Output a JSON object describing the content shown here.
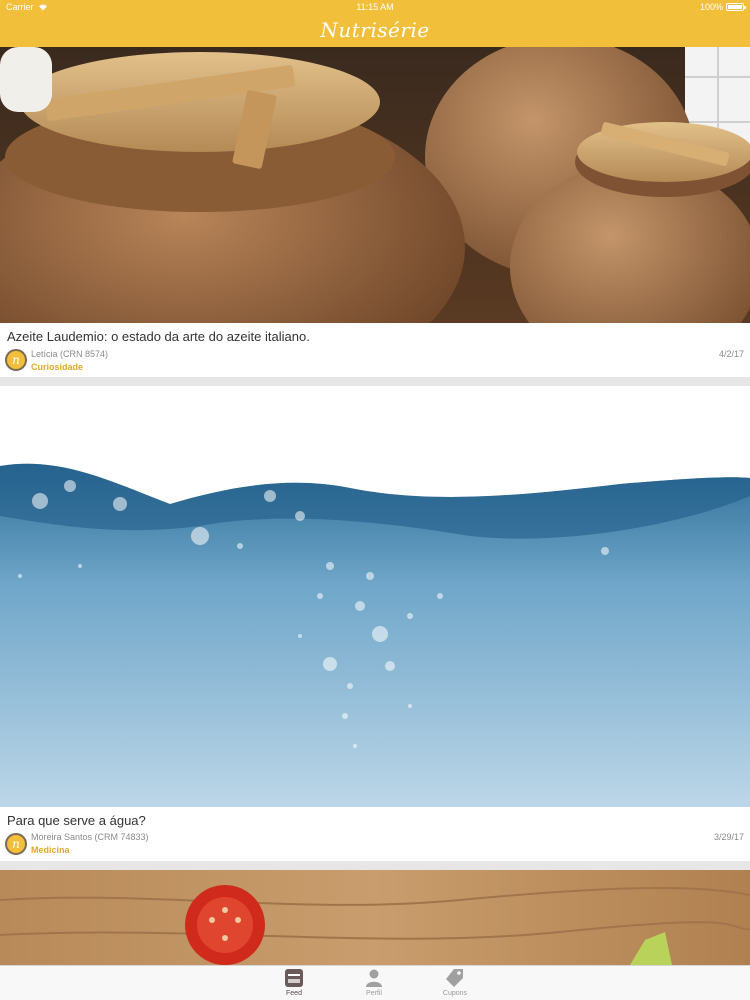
{
  "status_bar": {
    "carrier": "Carrier",
    "time": "11:15 AM",
    "battery": "100%",
    "battery_level": 1.0
  },
  "header": {
    "title": "Nutrisérie"
  },
  "feed": {
    "posts": [
      {
        "title": "Azeite Laudemio: o estado da arte do azeite italiano.",
        "author": "Letícia  (CRN 8574)",
        "category": "Curiosidade",
        "date": "4/2/17",
        "avatar_letter": "n"
      },
      {
        "title": "Para que serve a água?",
        "author": "Moreira Santos (CRM 74833)",
        "category": "Medicina",
        "date": "3/29/17",
        "avatar_letter": "n"
      }
    ]
  },
  "tabbar": {
    "tabs": [
      {
        "label": "Feed",
        "icon": "feed-icon",
        "active": true
      },
      {
        "label": "Perfil",
        "icon": "profile-icon",
        "active": false
      },
      {
        "label": "Cupons",
        "icon": "tag-icon",
        "active": false
      }
    ]
  },
  "colors": {
    "header": "#f2bf3b",
    "accent": "#e0a82a",
    "separator": "#e6e6e6"
  }
}
